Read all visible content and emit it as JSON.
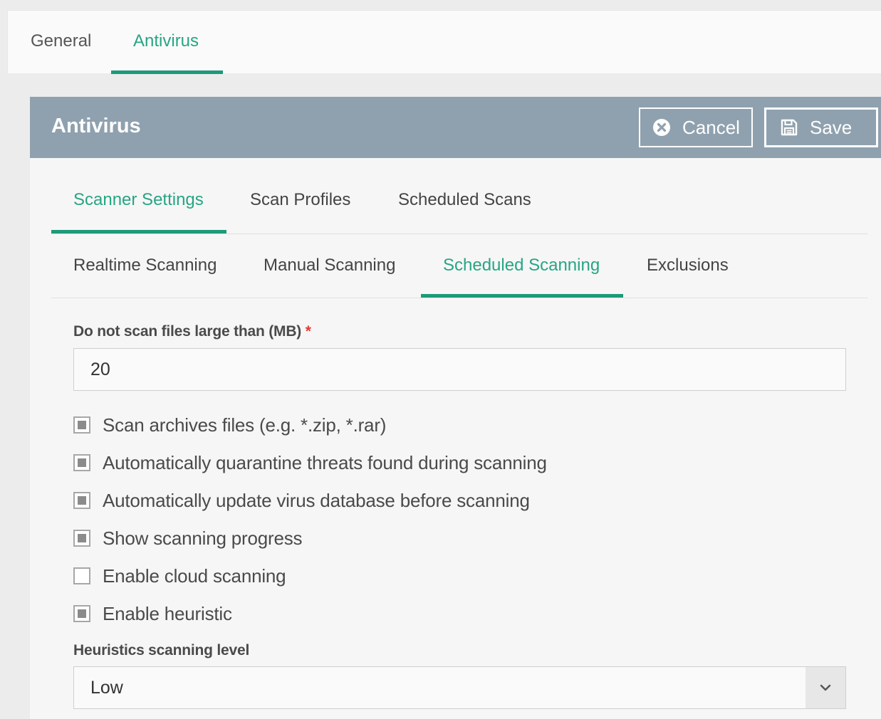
{
  "top_tabs": [
    {
      "label": "General",
      "active": false
    },
    {
      "label": "Antivirus",
      "active": true
    }
  ],
  "panel": {
    "title": "Antivirus",
    "cancel_label": "Cancel",
    "save_label": "Save",
    "cancel_icon": "close-circle-icon",
    "save_icon": "floppy-disk-icon"
  },
  "section_tabs": [
    {
      "label": "Scanner Settings",
      "active": true
    },
    {
      "label": "Scan Profiles",
      "active": false
    },
    {
      "label": "Scheduled Scans",
      "active": false
    }
  ],
  "sub_tabs": [
    {
      "label": "Realtime Scanning",
      "active": false
    },
    {
      "label": "Manual Scanning",
      "active": false
    },
    {
      "label": "Scheduled Scanning",
      "active": true
    },
    {
      "label": "Exclusions",
      "active": false
    }
  ],
  "form": {
    "max_size_label": "Do not scan files large than (MB)",
    "required_mark": "*",
    "max_size_value": "20",
    "checkboxes": [
      {
        "label": "Scan archives files (e.g. *.zip, *.rar)",
        "checked": true
      },
      {
        "label": "Automatically quarantine threats found during scanning",
        "checked": true
      },
      {
        "label": "Automatically update virus database before scanning",
        "checked": true
      },
      {
        "label": "Show scanning progress",
        "checked": true
      },
      {
        "label": "Enable cloud scanning",
        "checked": false
      },
      {
        "label": "Enable heuristic",
        "checked": true
      }
    ],
    "heuristics_label": "Heuristics scanning level",
    "heuristics_value": "Low",
    "dropdown_icon": "chevron-down-icon"
  },
  "colors": {
    "accent": "#1d9a78",
    "header_bg": "#8fa1ae",
    "required": "#e53935"
  }
}
